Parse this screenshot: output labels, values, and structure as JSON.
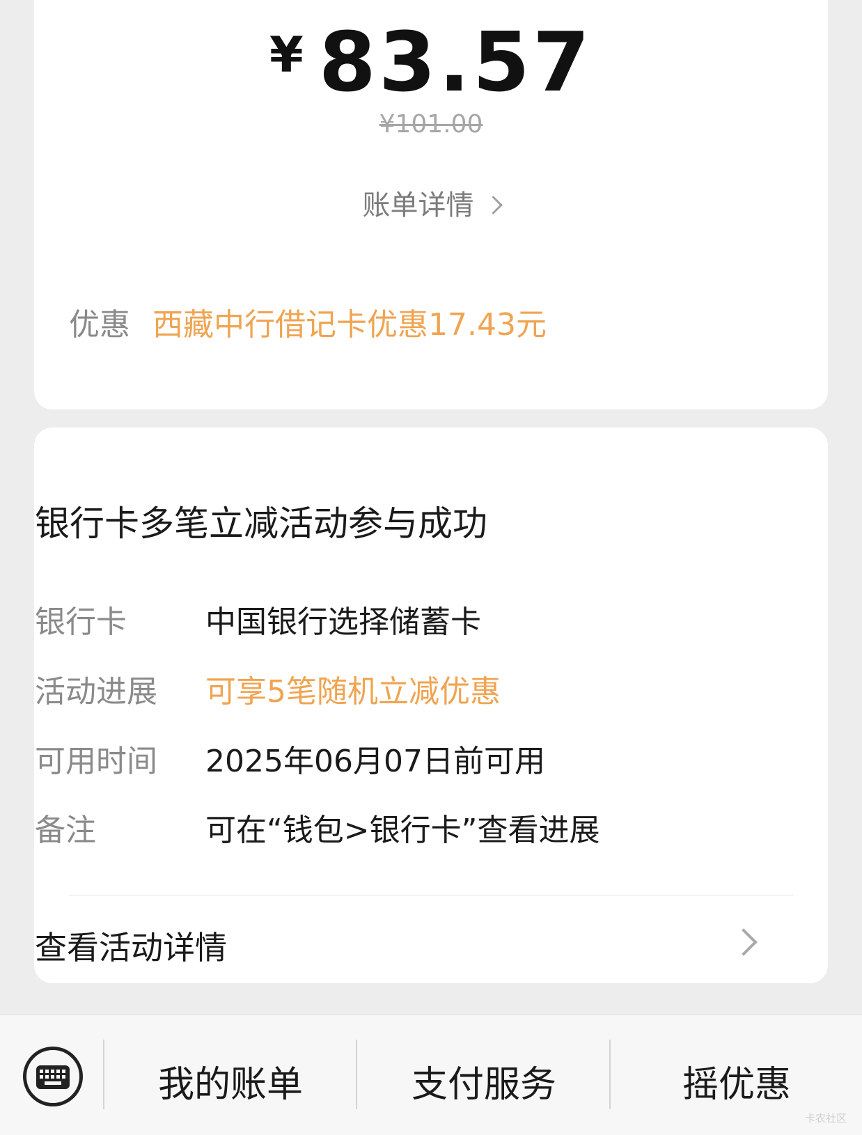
{
  "payment": {
    "currency_symbol": "¥",
    "amount": "83.57",
    "original_price": "¥101.00",
    "bill_detail_label": "账单详情",
    "discount_label": "优惠",
    "discount_value": "西藏中行借记卡优惠17.43元"
  },
  "activity": {
    "title": "银行卡多笔立减活动参与成功",
    "rows": [
      {
        "label": "银行卡",
        "value": "中国银行选择储蓄卡"
      },
      {
        "label": "活动进展",
        "value": "可享5笔随机立减优惠"
      },
      {
        "label": "可用时间",
        "value": "2025年06月07日前可用"
      },
      {
        "label": "备注",
        "value": "可在“钱包>银行卡”查看进展"
      }
    ],
    "detail_link": "查看活动详情"
  },
  "bottom_bar": {
    "keyboard_icon": "keyboard-icon",
    "tabs": [
      "我的账单",
      "支付服务",
      "摇优惠"
    ]
  },
  "watermark": "卡农社区",
  "colors": {
    "accent_orange": "#f0a451",
    "background": "#ededed",
    "card": "#ffffff"
  }
}
